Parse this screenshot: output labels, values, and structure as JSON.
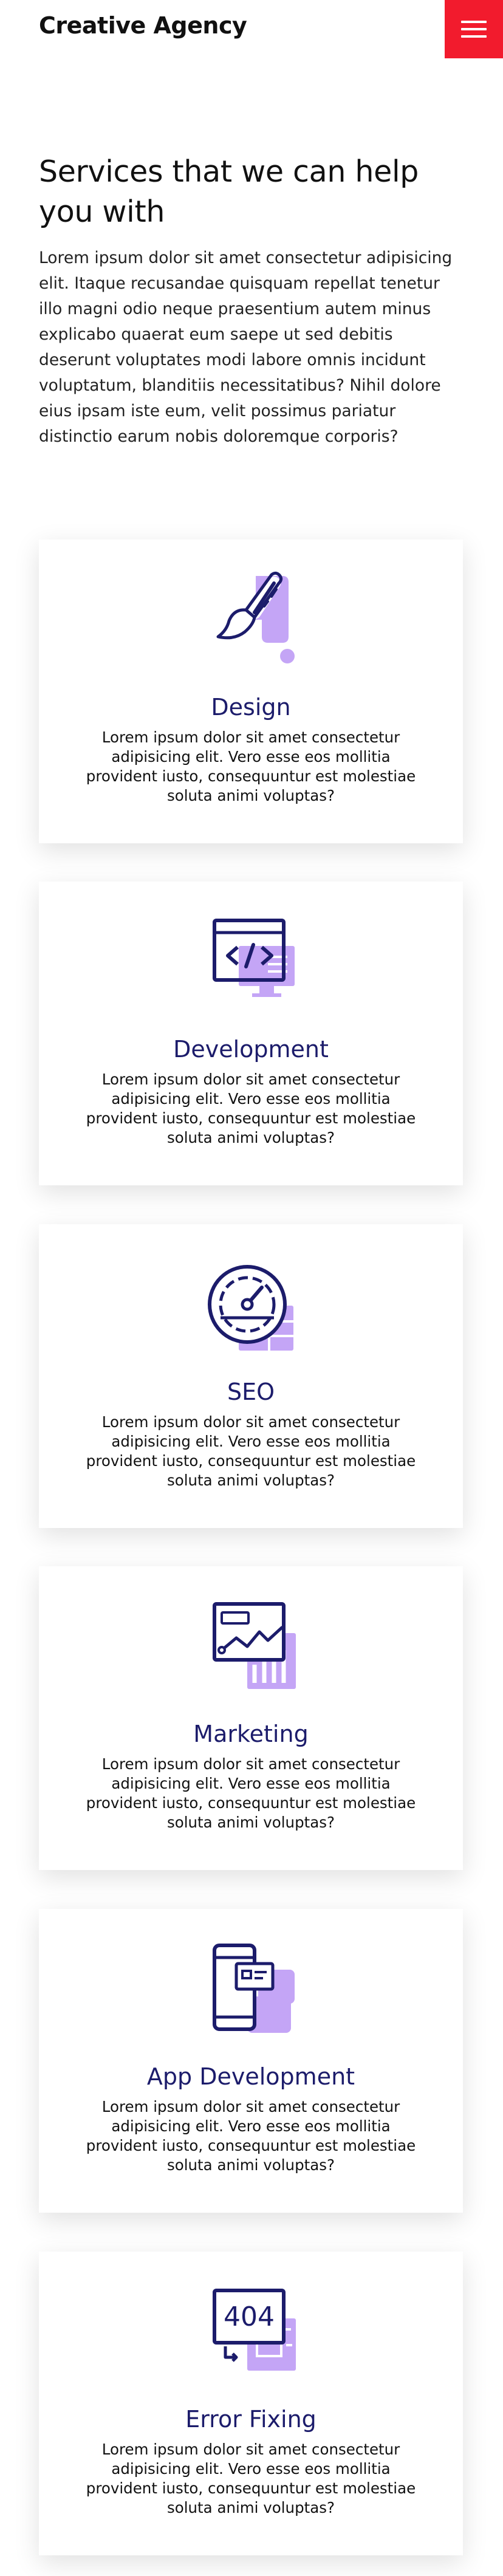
{
  "header": {
    "brand": "Creative Agency"
  },
  "intro": {
    "heading": "Services that we can help you with",
    "body": "Lorem ipsum dolor sit amet consectetur adipisicing elit. Itaque recusandae quisquam repellat tenetur illo magni odio neque praesentium autem minus explicabo quaerat eum saepe ut sed debitis deserunt voluptates modi labore omnis incidunt voluptatum, blanditiis necessitatibus? Nihil dolore eius ipsam iste eum, velit possimus pariatur distinctio earum nobis doloremque corporis?"
  },
  "colors": {
    "accent": "#f21b2d",
    "icon_primary": "#1c1c6b",
    "icon_secondary": "#c4a5f6"
  },
  "services": [
    {
      "title": "Design",
      "icon": "paint-brush-icon",
      "description": "Lorem ipsum dolor sit amet consectetur adipisicing elit. Vero esse eos mollitia provident iusto, consequuntur est molestiae soluta animi voluptas?"
    },
    {
      "title": "Development",
      "icon": "code-window-icon",
      "description": "Lorem ipsum dolor sit amet consectetur adipisicing elit. Vero esse eos mollitia provident iusto, consequuntur est molestiae soluta animi voluptas?"
    },
    {
      "title": "SEO",
      "icon": "speedometer-icon",
      "description": "Lorem ipsum dolor sit amet consectetur adipisicing elit. Vero esse eos mollitia provident iusto, consequuntur est molestiae soluta animi voluptas?"
    },
    {
      "title": "Marketing",
      "icon": "analytics-chart-icon",
      "description": "Lorem ipsum dolor sit amet consectetur adipisicing elit. Vero esse eos mollitia provident iusto, consequuntur est molestiae soluta animi voluptas?"
    },
    {
      "title": "App Development",
      "icon": "mobile-app-icon",
      "description": "Lorem ipsum dolor sit amet consectetur adipisicing elit. Vero esse eos mollitia provident iusto, consequuntur est molestiae soluta animi voluptas?"
    },
    {
      "title": "Error Fixing",
      "icon": "error-404-icon",
      "icon_text": "404",
      "description": "Lorem ipsum dolor sit amet consectetur adipisicing elit. Vero esse eos mollitia provident iusto, consequuntur est molestiae soluta animi voluptas?"
    }
  ]
}
